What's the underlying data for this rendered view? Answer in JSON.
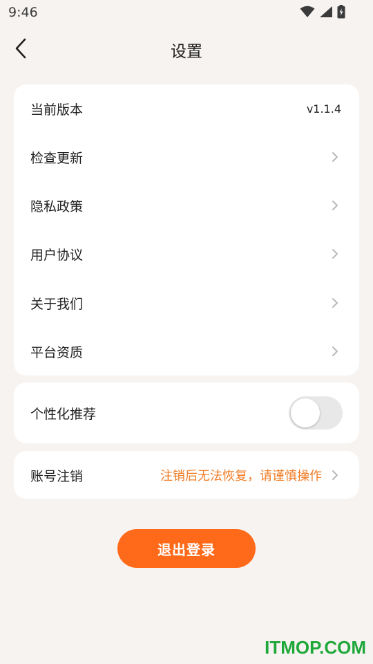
{
  "status_bar": {
    "time": "9:46",
    "icons": [
      "wifi-icon",
      "signal-icon",
      "battery-charging-icon"
    ]
  },
  "header": {
    "title": "设置",
    "back_icon": "back-chevron-icon"
  },
  "info_card": {
    "items": [
      {
        "label": "当前版本",
        "value": "v1.1.4"
      },
      {
        "label": "检查更新"
      },
      {
        "label": "隐私政策"
      },
      {
        "label": "用户协议"
      },
      {
        "label": "关于我们"
      },
      {
        "label": "平台资质"
      }
    ]
  },
  "personalization": {
    "label": "个性化推荐",
    "enabled": false
  },
  "account": {
    "label": "账号注销",
    "hint": "注销后无法恢复，请谨慎操作"
  },
  "logout": {
    "label": "退出登录"
  },
  "watermark": "ITMOP.COM",
  "colors": {
    "accent": "#ff6a1a",
    "hint": "#f07c26",
    "background": "#f7f3f0",
    "card": "#ffffff",
    "watermark": "#1fa83a"
  }
}
